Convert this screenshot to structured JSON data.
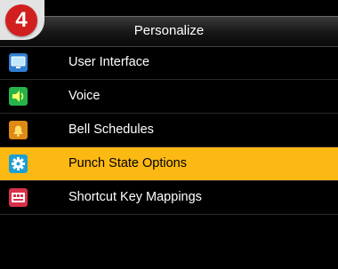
{
  "step_badge": "4",
  "header": {
    "title": "Personalize"
  },
  "menu": {
    "items": [
      {
        "label": "User Interface",
        "icon": "monitor-icon",
        "selected": false
      },
      {
        "label": "Voice",
        "icon": "speaker-icon",
        "selected": false
      },
      {
        "label": "Bell Schedules",
        "icon": "bell-icon",
        "selected": false
      },
      {
        "label": "Punch State Options",
        "icon": "gear-icon",
        "selected": true
      },
      {
        "label": "Shortcut Key Mappings",
        "icon": "keyboard-icon",
        "selected": false
      }
    ]
  },
  "colors": {
    "selected_background": "#fdb913",
    "badge": "#d11f1f",
    "screen_background": "#000000"
  }
}
